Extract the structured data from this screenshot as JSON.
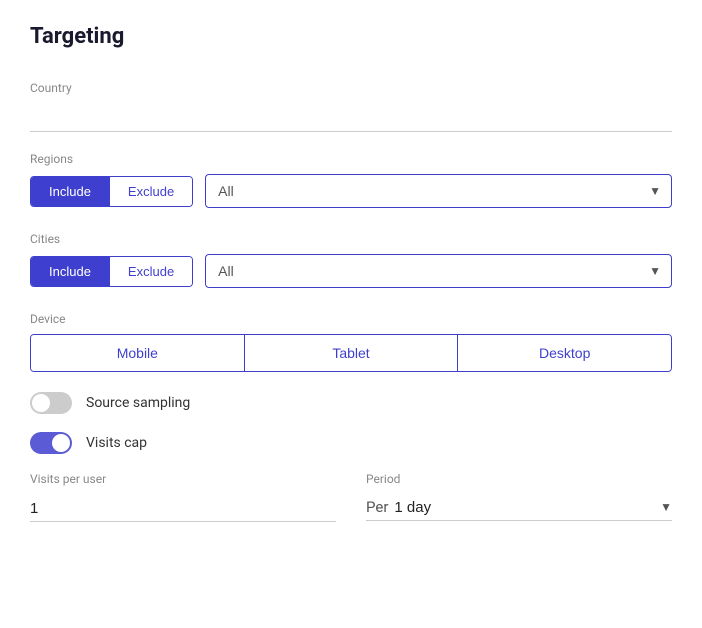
{
  "title": "Targeting",
  "country": {
    "label": "Country",
    "placeholder": ""
  },
  "regions": {
    "label": "Regions",
    "include_label": "Include",
    "exclude_label": "Exclude",
    "select_default": "All"
  },
  "cities": {
    "label": "Cities",
    "include_label": "Include",
    "exclude_label": "Exclude",
    "select_default": "All"
  },
  "device": {
    "label": "Device",
    "options": [
      "Mobile",
      "Tablet",
      "Desktop"
    ]
  },
  "source_sampling": {
    "label": "Source sampling",
    "enabled": false
  },
  "visits_cap": {
    "label": "Visits cap",
    "enabled": true
  },
  "visits_per_user": {
    "label": "Visits per user",
    "value": "1"
  },
  "period": {
    "label": "Period",
    "prefix": "Per",
    "value": "1 day"
  }
}
